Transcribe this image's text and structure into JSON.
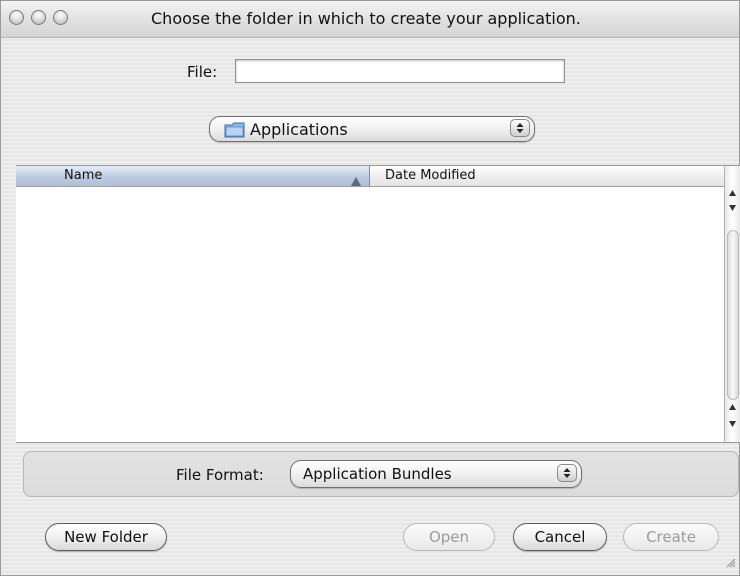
{
  "window": {
    "title": "Choose the folder in which to create your application."
  },
  "file": {
    "label": "File:",
    "value": "",
    "placeholder": ""
  },
  "location": {
    "selected": "Applications",
    "icon": "folder-icon"
  },
  "browser": {
    "columns": [
      {
        "label": "Name",
        "sort": "ascending"
      },
      {
        "label": "Date Modified"
      }
    ],
    "rows": []
  },
  "format": {
    "label": "File Format:",
    "selected": "Application Bundles"
  },
  "buttons": {
    "new_folder": "New Folder",
    "open": "Open",
    "cancel": "Cancel",
    "create": "Create"
  }
}
